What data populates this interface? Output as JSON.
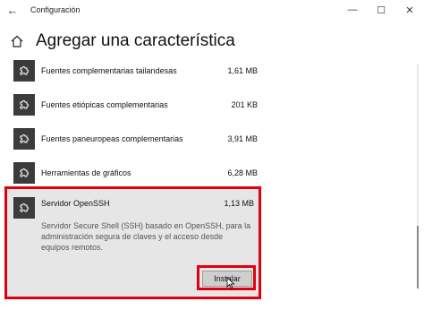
{
  "titlebar": {
    "back_glyph": "←",
    "title": "Configuración",
    "minimize": "—",
    "maximize": "☐",
    "close": "✕"
  },
  "header": {
    "title": "Agregar una característica"
  },
  "items": [
    {
      "name": "Fuentes complementarias tailandesas",
      "size": "1,61 MB"
    },
    {
      "name": "Fuentes etiópicas complementarias",
      "size": "201 KB"
    },
    {
      "name": "Fuentes paneuropeas complementarias",
      "size": "3,91 MB"
    },
    {
      "name": "Herramientas de gráficos",
      "size": "6,28 MB"
    }
  ],
  "selected": {
    "name": "Servidor OpenSSH",
    "size": "1,13 MB",
    "description": "Servidor Secure Shell (SSH) basado en OpenSSH, para la administración segura de claves y el acceso desde equipos remotos.",
    "install_label": "Instalar"
  },
  "colors": {
    "highlight": "#e00010",
    "icon_bg": "#3b3b3b",
    "selected_bg": "#e6e6e6"
  }
}
